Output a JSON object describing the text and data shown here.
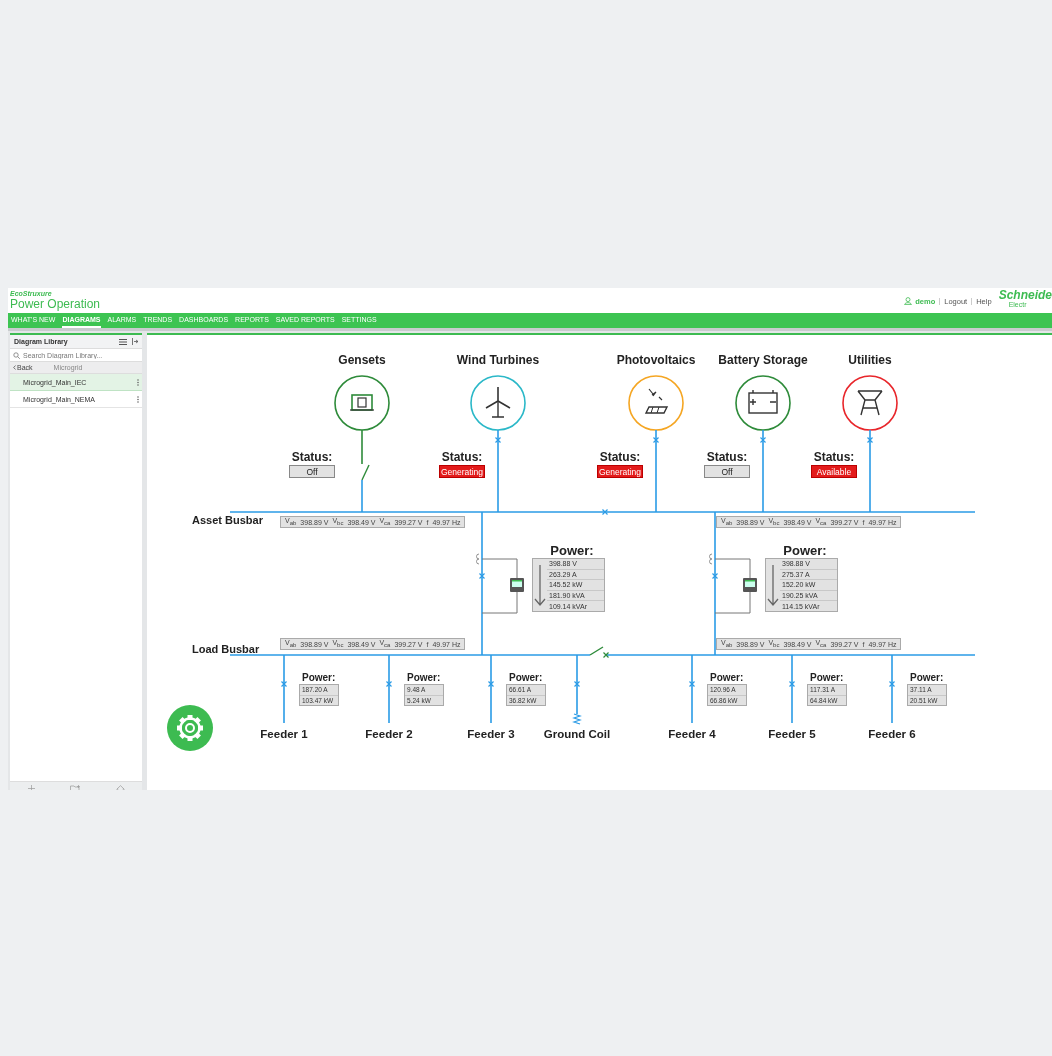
{
  "header": {
    "brand": "EcoStruxure",
    "product": "Power Operation",
    "user": "demo",
    "links": [
      "Logout",
      "Help"
    ],
    "logo": "Schneide",
    "logo_sub": "Electr"
  },
  "nav": [
    {
      "label": "WHAT'S NEW",
      "selected": false
    },
    {
      "label": "DIAGRAMS",
      "selected": true
    },
    {
      "label": "ALARMS",
      "selected": false
    },
    {
      "label": "TRENDS",
      "selected": false
    },
    {
      "label": "DASHBOARDS",
      "selected": false
    },
    {
      "label": "REPORTS",
      "selected": false
    },
    {
      "label": "SAVED REPORTS",
      "selected": false
    },
    {
      "label": "SETTINGS",
      "selected": false
    }
  ],
  "sidebar": {
    "title": "Diagram Library",
    "search": {
      "placeholder": "Search Diagram Library..."
    },
    "back": "Back",
    "folder": "Microgrid",
    "items": [
      {
        "label": "Microgrid_Main_IEC",
        "selected": true
      },
      {
        "label": "Microgrid_Main_NEMA",
        "selected": false
      }
    ]
  },
  "diagram": {
    "sources": [
      {
        "name": "Gensets",
        "kind": "genset",
        "color": "#2e8b3a",
        "status_label": "Status:",
        "status": "Off",
        "highlighted": false,
        "switch_closed": false
      },
      {
        "name": "Wind Turbines",
        "kind": "wind",
        "color": "#2bb8c8",
        "status_label": "Status:",
        "status": "Generating",
        "highlighted": true,
        "switch_closed": true
      },
      {
        "name": "Photovoltaics",
        "kind": "solar",
        "color": "#f5a623",
        "status_label": "Status:",
        "status": "Generating",
        "highlighted": true,
        "switch_closed": true
      },
      {
        "name": "Battery Storage",
        "kind": "battery",
        "color": "#2e8b3a",
        "status_label": "Status:",
        "status": "Off",
        "highlighted": false,
        "switch_closed": true
      },
      {
        "name": "Utilities",
        "kind": "utility",
        "color": "#e8262b",
        "status_label": "Status:",
        "status": "Available",
        "highlighted": true,
        "switch_closed": true
      }
    ],
    "busbars": [
      {
        "name": "Asset Busbar",
        "strips": [
          [
            {
              "label": "V$_{ab}$",
              "value": "398.89 V"
            },
            {
              "label": "V$_{bc}$",
              "value": "398.49 V"
            },
            {
              "label": "V$_{ca}$",
              "value": "399.27 V"
            },
            {
              "label": "f",
              "value": "49.97 Hz"
            }
          ],
          [
            {
              "label": "V$_{ab}$",
              "value": "398.89 V"
            },
            {
              "label": "V$_{bc}$",
              "value": "398.49 V"
            },
            {
              "label": "V$_{ca}$",
              "value": "399.27 V"
            },
            {
              "label": "f",
              "value": "49.97 Hz"
            }
          ]
        ]
      },
      {
        "name": "Load Busbar",
        "strips": [
          [
            {
              "label": "V$_{ab}$",
              "value": "398.89 V"
            },
            {
              "label": "V$_{bc}$",
              "value": "398.49 V"
            },
            {
              "label": "V$_{ca}$",
              "value": "399.27 V"
            },
            {
              "label": "f",
              "value": "49.97 Hz"
            }
          ],
          [
            {
              "label": "V$_{ab}$",
              "value": "398.89 V"
            },
            {
              "label": "V$_{bc}$",
              "value": "398.49 V"
            },
            {
              "label": "V$_{ca}$",
              "value": "399.27 V"
            },
            {
              "label": "f",
              "value": "49.97 Hz"
            }
          ]
        ]
      }
    ],
    "meters": [
      {
        "title": "Power:",
        "readings": [
          "398.88 V",
          "263.29 A",
          "145.52 kW",
          "181.90 kVA",
          "109.14 kVAr"
        ]
      },
      {
        "title": "Power:",
        "readings": [
          "398.88 V",
          "275.37 A",
          "152.20 kW",
          "190.25 kVA",
          "114.15 kVAr"
        ]
      }
    ],
    "tie_switch": {
      "closed": false
    },
    "feeders": [
      {
        "name": "Feeder 1",
        "kind": "feeder",
        "title": "Power:",
        "readings": [
          "187.20 A",
          "103.47 kW"
        ]
      },
      {
        "name": "Feeder 2",
        "kind": "feeder",
        "title": "Power:",
        "readings": [
          "9.48 A",
          "5.24 kW"
        ]
      },
      {
        "name": "Feeder 3",
        "kind": "feeder",
        "title": "Power:",
        "readings": [
          "66.61 A",
          "36.82 kW"
        ]
      },
      {
        "name": "Ground Coil",
        "kind": "ground"
      },
      {
        "name": "Feeder 4",
        "kind": "feeder",
        "title": "Power:",
        "readings": [
          "120.96 A",
          "66.86 kW"
        ]
      },
      {
        "name": "Feeder 5",
        "kind": "feeder",
        "title": "Power:",
        "readings": [
          "117.31 A",
          "64.84 kW"
        ]
      },
      {
        "name": "Feeder 6",
        "kind": "feeder",
        "title": "Power:",
        "readings": [
          "37.11 A",
          "20.51 kW"
        ]
      }
    ]
  }
}
